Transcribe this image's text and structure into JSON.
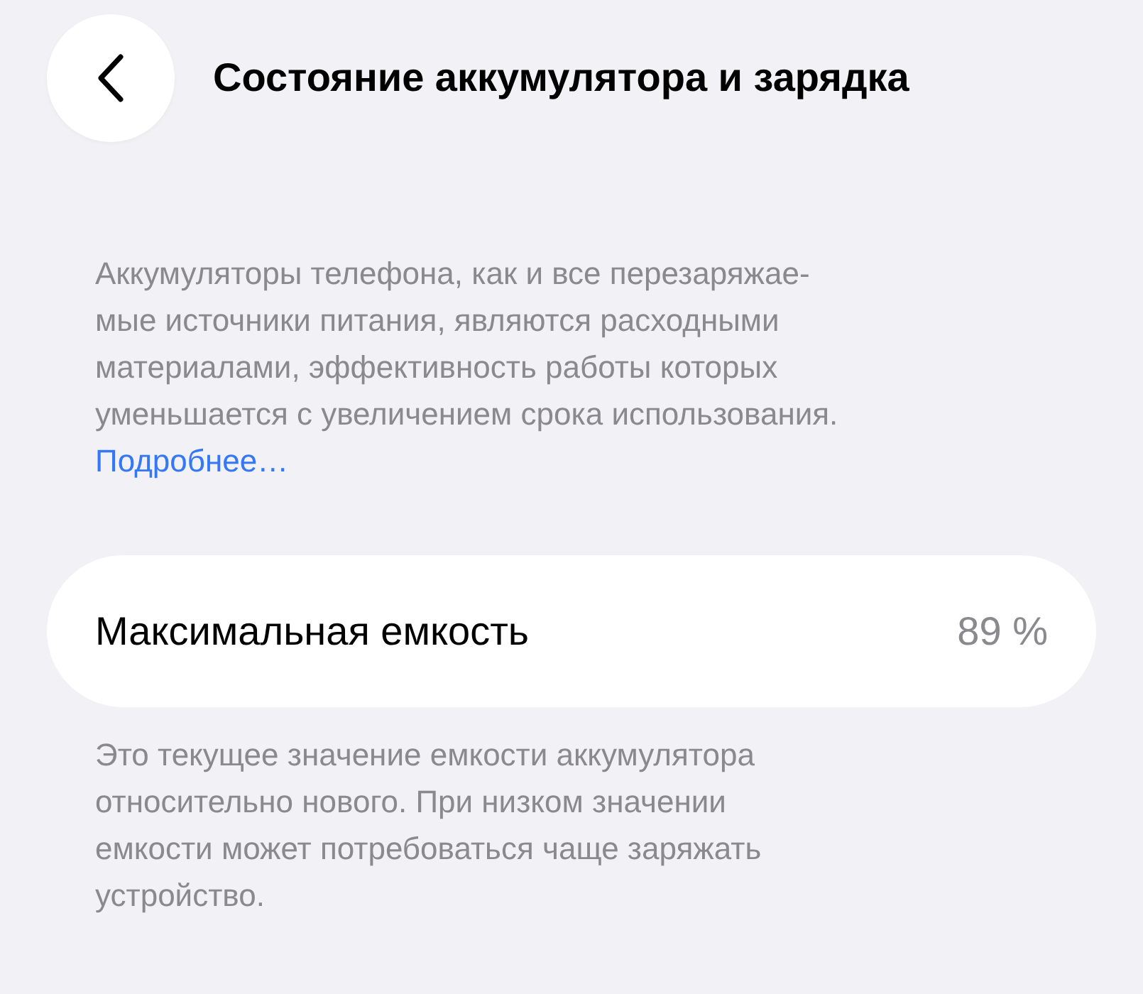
{
  "header": {
    "title": "Состояние аккумулятора и зарядка"
  },
  "intro": {
    "text": "Аккумуляторы телефона, как и все перезаряжае-\nмые источники питания, являются расходными\nматериалами, эффективность работы которых\nуменьшается с увеличением срока использования.",
    "link": "Подробнее…"
  },
  "capacity": {
    "label": "Максимальная емкость",
    "value": "89 %"
  },
  "footnote": {
    "text": "Это текущее значение емкости аккумулятора\nотносительно нового. При низком значении\nемкости может потребоваться чаще заряжать\nустройство."
  }
}
